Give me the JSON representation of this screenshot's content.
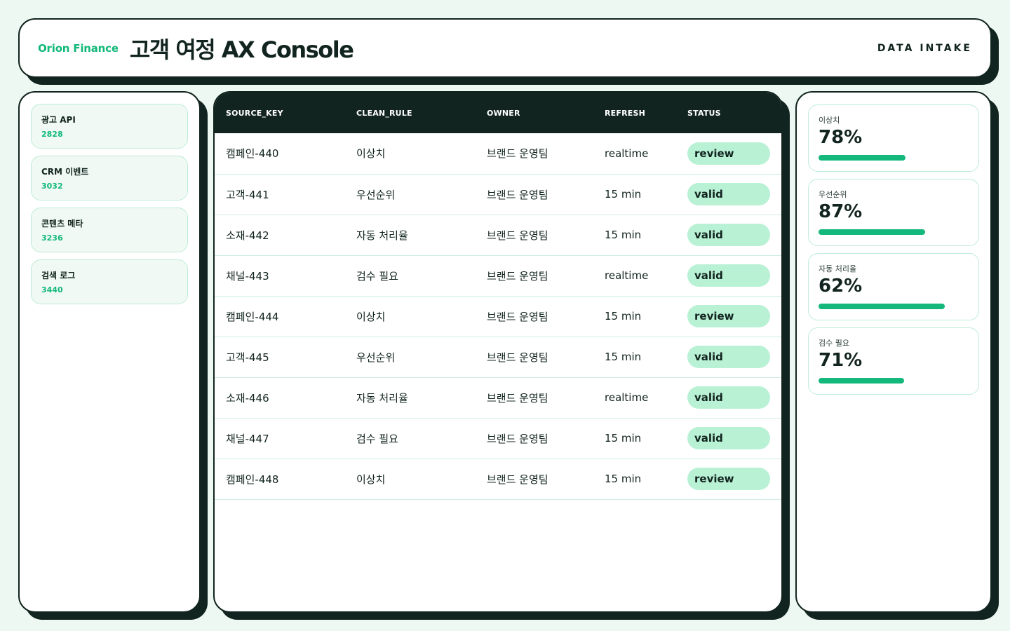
{
  "header": {
    "brand": "Orion Finance",
    "title": "고객 여정 AX Console",
    "tag": "DATA INTAKE"
  },
  "sources": [
    {
      "name": "광고 API",
      "count": "2828"
    },
    {
      "name": "CRM 이벤트",
      "count": "3032"
    },
    {
      "name": "콘텐츠 메타",
      "count": "3236"
    },
    {
      "name": "검색 로그",
      "count": "3440"
    }
  ],
  "table": {
    "columns": [
      "SOURCE_KEY",
      "CLEAN_RULE",
      "OWNER",
      "REFRESH",
      "STATUS"
    ],
    "rows": [
      [
        "캠페인-440",
        "이상치",
        "브랜드 운영팀",
        "realtime",
        "review"
      ],
      [
        "고객-441",
        "우선순위",
        "브랜드 운영팀",
        "15 min",
        "valid"
      ],
      [
        "소재-442",
        "자동 처리율",
        "브랜드 운영팀",
        "15 min",
        "valid"
      ],
      [
        "채널-443",
        "검수 필요",
        "브랜드 운영팀",
        "realtime",
        "valid"
      ],
      [
        "캠페인-444",
        "이상치",
        "브랜드 운영팀",
        "15 min",
        "review"
      ],
      [
        "고객-445",
        "우선순위",
        "브랜드 운영팀",
        "15 min",
        "valid"
      ],
      [
        "소재-446",
        "자동 처리율",
        "브랜드 운영팀",
        "realtime",
        "valid"
      ],
      [
        "채널-447",
        "검수 필요",
        "브랜드 운영팀",
        "15 min",
        "valid"
      ],
      [
        "캠페인-448",
        "이상치",
        "브랜드 운영팀",
        "15 min",
        "review"
      ]
    ]
  },
  "metrics": [
    {
      "label": "이상치",
      "value": "78%",
      "fill": 0.62
    },
    {
      "label": "우선순위",
      "value": "87%",
      "fill": 0.76
    },
    {
      "label": "자동 처리율",
      "value": "62%",
      "fill": 0.9
    },
    {
      "label": "검수 필요",
      "value": "71%",
      "fill": 0.61
    }
  ],
  "colors": {
    "accent": "#12b87a",
    "dark": "#12241f",
    "pill": "#b9f1d5",
    "background": "#eef8f3"
  }
}
